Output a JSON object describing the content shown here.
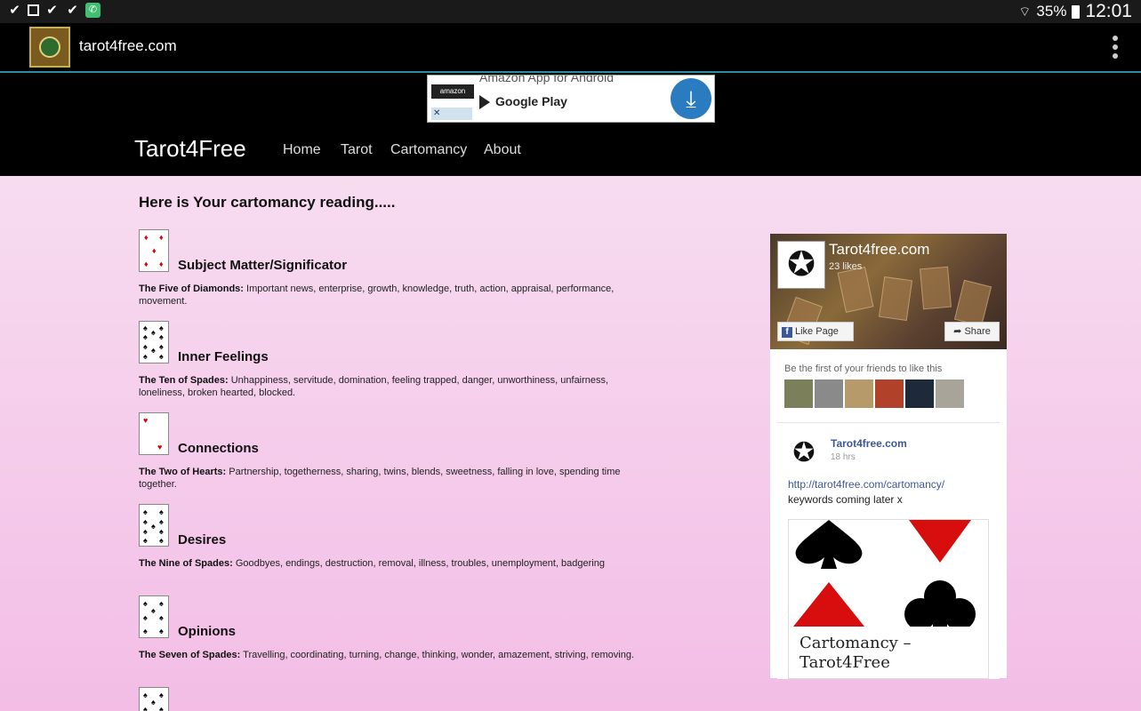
{
  "status_bar": {
    "left_icons": [
      "check-icon",
      "image-icon",
      "check-icon",
      "check-icon",
      "messenger-icon"
    ],
    "battery": "35%",
    "time": "12:01"
  },
  "app_bar": {
    "title": "tarot4free.com",
    "overflow_icon": "more-vertical-icon"
  },
  "ad": {
    "brand": "amazon",
    "line1": "Amazon App for Android",
    "store": "Google Play",
    "download_icon": "download-icon"
  },
  "site": {
    "brand": "Tarot4Free",
    "nav": [
      "Home",
      "Tarot",
      "Cartomancy",
      "About"
    ]
  },
  "main": {
    "heading": "Here is Your cartomancy reading.....",
    "readings": [
      {
        "title": "Subject Matter/Significator",
        "card": "The Five of Diamonds:",
        "text": "Important news, enterprise, growth, knowledge, truth, action, appraisal, performance, movement.",
        "color": "#d00000"
      },
      {
        "title": "Inner Feelings",
        "card": "The Ten of Spades:",
        "text": "Unhappiness, servitude, domination, feeling trapped, danger, unworthiness, unfairness, loneliness, broken hearted, blocked.",
        "color": "#000000"
      },
      {
        "title": "Connections",
        "card": "The Two of Hearts:",
        "text": "Partnership, togetherness, sharing, twins, blends, sweetness, falling in love, spending time together.",
        "color": "#d00000"
      },
      {
        "title": "Desires",
        "card": "The Nine of Spades:",
        "text": "Goodbyes, endings, destruction, removal, illness, troubles, unemployment, badgering",
        "color": "#000000"
      },
      {
        "title": "Opinions",
        "card": "The Seven of Spades:",
        "text": "Travelling, coordinating, turning, change, thinking, wonder, amazement, striving, removing.",
        "color": "#000000"
      }
    ]
  },
  "facebook": {
    "page_name": "Tarot4free.com",
    "likes": "23 likes",
    "like_button": "Like Page",
    "share_button": "Share",
    "friends_text": "Be the first of your friends to like this",
    "post": {
      "name": "Tarot4free.com",
      "time": "18 hrs",
      "link": "http://tarot4free.com/cartomancy/",
      "text": "keywords coming later x",
      "preview_title": "Cartomancy – Tarot4Free"
    }
  }
}
